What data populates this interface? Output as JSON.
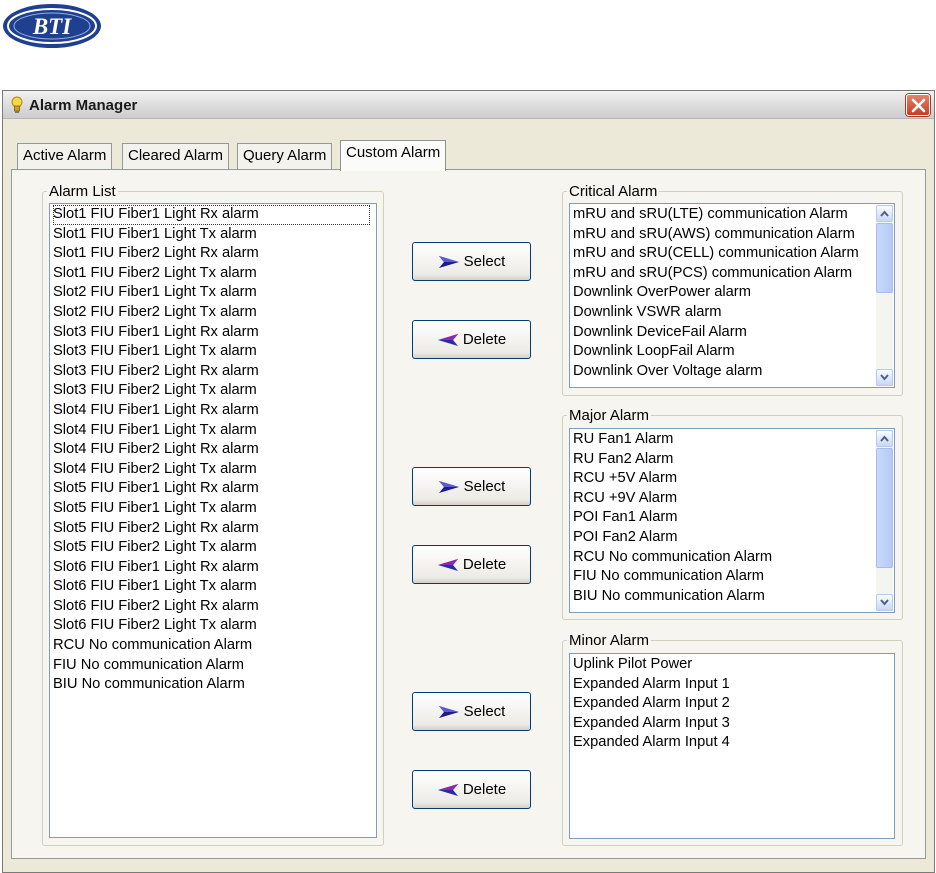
{
  "window": {
    "title": "Alarm Manager"
  },
  "tabs": [
    {
      "label": "Active Alarm",
      "active": false
    },
    {
      "label": "Cleared Alarm",
      "active": false
    },
    {
      "label": "Query Alarm",
      "active": false
    },
    {
      "label": "Custom Alarm",
      "active": true
    }
  ],
  "alarm_list": {
    "legend": "Alarm List",
    "items": [
      "Slot1 FIU Fiber1 Light Rx alarm",
      "Slot1 FIU Fiber1 Light Tx alarm",
      "Slot1 FIU Fiber2 Light Rx alarm",
      "Slot1 FIU Fiber2 Light Tx alarm",
      "Slot2 FIU Fiber1 Light Tx alarm",
      "Slot2 FIU Fiber2 Light Tx alarm",
      "Slot3 FIU Fiber1 Light Rx alarm",
      "Slot3 FIU Fiber1 Light Tx alarm",
      "Slot3 FIU Fiber2 Light Rx alarm",
      "Slot3 FIU Fiber2 Light Tx alarm",
      "Slot4 FIU Fiber1 Light Rx alarm",
      "Slot4 FIU Fiber1 Light Tx alarm",
      "Slot4 FIU Fiber2 Light Rx alarm",
      "Slot4 FIU Fiber2 Light Tx alarm",
      "Slot5 FIU Fiber1 Light Rx alarm",
      "Slot5 FIU Fiber1 Light Tx alarm",
      "Slot5 FIU Fiber2 Light Rx alarm",
      "Slot5 FIU Fiber2 Light Tx alarm",
      "Slot6 FIU Fiber1 Light Rx alarm",
      "Slot6 FIU Fiber1 Light Tx alarm",
      "Slot6 FIU Fiber2 Light Rx alarm",
      "Slot6 FIU Fiber2 Light Tx alarm",
      "RCU No communication Alarm",
      "FIU No communication Alarm",
      "BIU No communication Alarm"
    ]
  },
  "buttons": {
    "select_label": "Select",
    "delete_label": "Delete"
  },
  "critical": {
    "legend": "Critical Alarm",
    "items": [
      "mRU and sRU(LTE) communication Alarm",
      "mRU and sRU(AWS) communication Alarm",
      "mRU and sRU(CELL) communication Alarm",
      "mRU and sRU(PCS) communication Alarm",
      "Downlink OverPower alarm",
      "Downlink VSWR alarm",
      "Downlink DeviceFail Alarm",
      "Downlink LoopFail Alarm",
      "Downlink Over Voltage alarm"
    ]
  },
  "major": {
    "legend": "Major Alarm",
    "items": [
      "RU Fan1 Alarm",
      "RU Fan2 Alarm",
      "RCU +5V Alarm",
      "RCU +9V Alarm",
      "POI Fan1 Alarm",
      "POI Fan2 Alarm",
      "RCU No communication Alarm",
      "FIU No communication Alarm",
      "BIU No communication Alarm"
    ]
  },
  "minor": {
    "legend": "Minor Alarm",
    "items": [
      "Uplink Pilot Power",
      "Expanded Alarm Input 1",
      "Expanded Alarm Input 2",
      "Expanded Alarm Input 3",
      "Expanded Alarm Input 4"
    ]
  },
  "colors": {
    "select_arrow": "#1c1c8c",
    "delete_arrow": "#2a2aa8",
    "logo_blue": "#1f3f8f"
  },
  "icons": {
    "logo": "company-logo",
    "title": "lightbulb-icon",
    "close": "close-icon",
    "select": "arrow-right-icon",
    "delete": "arrow-left-icon"
  }
}
